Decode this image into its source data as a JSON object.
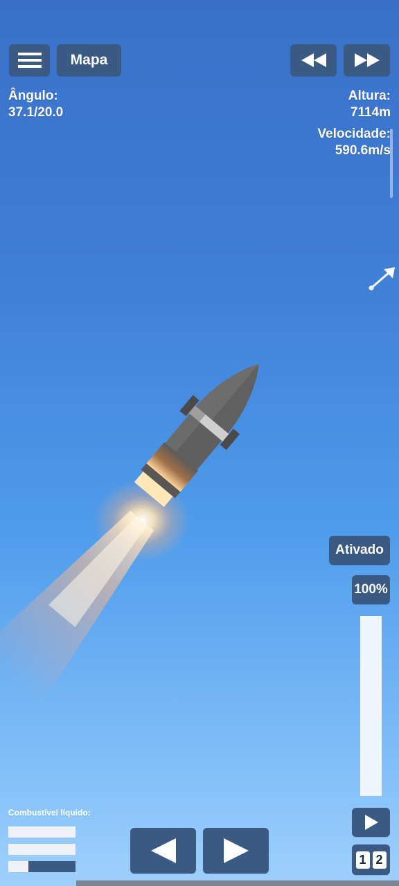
{
  "top_bar": {
    "menu_icon": "hamburger-menu-icon",
    "map_label": "Mapa",
    "rewind_icon": "rewind-icon",
    "fast_forward_icon": "fast-forward-icon"
  },
  "telemetry": {
    "angle_label": "Ângulo:",
    "angle_value": "37.1/20.0",
    "altitude_label": "Altura:",
    "altitude_value": "7114m",
    "velocity_label": "Velocidade:",
    "velocity_value": "590.6m/s"
  },
  "controls": {
    "direction_arrow_icon": "direction-arrow-icon",
    "engine_toggle_label": "Ativado",
    "throttle_label": "100%",
    "throttle_level": 1.0,
    "stage_button_icon": "play-icon",
    "rotate_left_icon": "left-triangle-icon",
    "rotate_right_icon": "right-triangle-icon",
    "stage_numbers": [
      "1",
      "2"
    ]
  },
  "fuel": {
    "label": "Combustível líquido:",
    "tanks": [
      {
        "level": 1.0
      },
      {
        "level": 1.0
      },
      {
        "level": 0.3
      }
    ]
  },
  "colors": {
    "button": "#3b5a83",
    "sky_top": "#3a70c8",
    "sky_bottom": "#9fd0fc",
    "rocket_body": "#5f5f5f",
    "flame": "#ffd27a"
  }
}
